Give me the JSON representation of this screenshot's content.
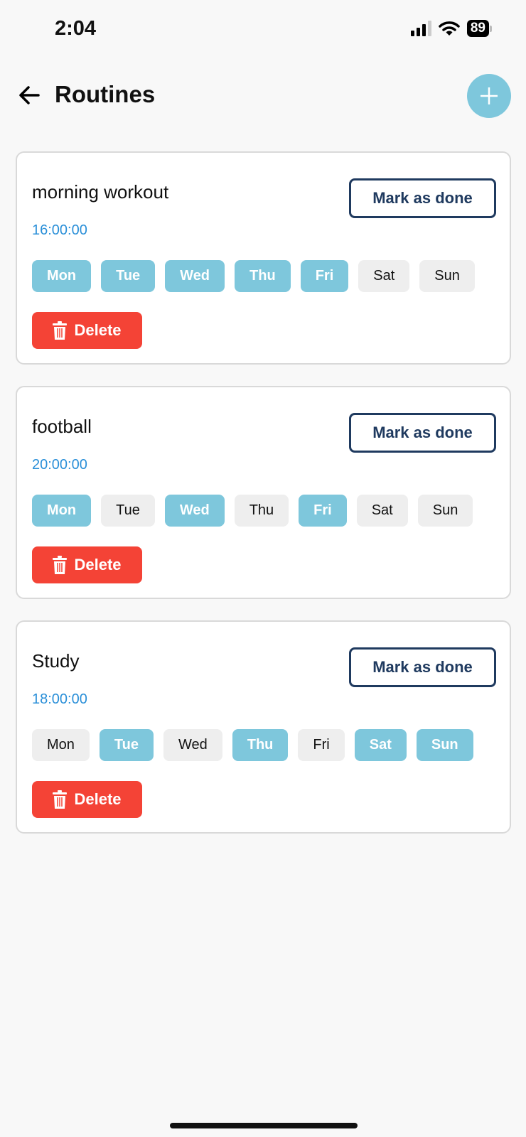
{
  "status_bar": {
    "time": "2:04",
    "battery": "89"
  },
  "header": {
    "title": "Routines",
    "back_icon": "arrow-left-icon",
    "add_icon": "plus-icon"
  },
  "colors": {
    "accent": "#7ec7dc",
    "delete": "#f44336",
    "time": "#2a8fd8",
    "mark_border": "#1f3a5f",
    "day_off": "#eeeeee"
  },
  "routines": [
    {
      "name": "morning workout",
      "time": "16:00:00",
      "mark_label": "Mark as done",
      "delete_label": "Delete",
      "days": [
        {
          "label": "Mon",
          "active": true
        },
        {
          "label": "Tue",
          "active": true
        },
        {
          "label": "Wed",
          "active": true
        },
        {
          "label": "Thu",
          "active": true
        },
        {
          "label": "Fri",
          "active": true
        },
        {
          "label": "Sat",
          "active": false
        },
        {
          "label": "Sun",
          "active": false
        }
      ]
    },
    {
      "name": "football",
      "time": "20:00:00",
      "mark_label": "Mark as done",
      "delete_label": "Delete",
      "days": [
        {
          "label": "Mon",
          "active": true
        },
        {
          "label": "Tue",
          "active": false
        },
        {
          "label": "Wed",
          "active": true
        },
        {
          "label": "Thu",
          "active": false
        },
        {
          "label": "Fri",
          "active": true
        },
        {
          "label": "Sat",
          "active": false
        },
        {
          "label": "Sun",
          "active": false
        }
      ]
    },
    {
      "name": "Study",
      "time": "18:00:00",
      "mark_label": "Mark as done",
      "delete_label": "Delete",
      "days": [
        {
          "label": "Mon",
          "active": false
        },
        {
          "label": "Tue",
          "active": true
        },
        {
          "label": "Wed",
          "active": false
        },
        {
          "label": "Thu",
          "active": true
        },
        {
          "label": "Fri",
          "active": false
        },
        {
          "label": "Sat",
          "active": true
        },
        {
          "label": "Sun",
          "active": true
        }
      ]
    }
  ]
}
